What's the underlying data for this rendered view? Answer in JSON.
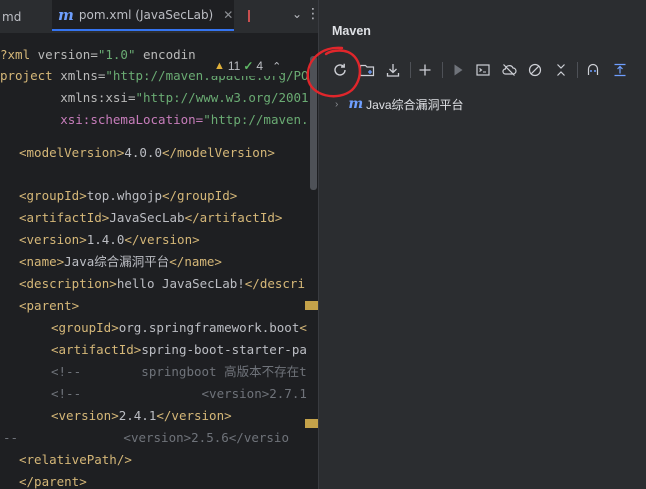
{
  "editor": {
    "tabs": [
      {
        "label": "md"
      },
      {
        "label": "pom.xml (JavaSecLab)",
        "icon": "maven-m-icon",
        "active": true
      }
    ],
    "inspection": {
      "warnings": "11",
      "passed": "4"
    },
    "code": {
      "l1_open": "?xml",
      "l1_attr1": " version=",
      "l1_val1": "\"1.0\"",
      "l1_attr2": " encodin",
      "l2_open": "project",
      "l2_attr": " xmlns=",
      "l2_val": "\"http://maven.apache.org/PO",
      "l3_pre": "        ",
      "l3_attr": "xmlns:xsi=",
      "l3_val": "\"http://www.w3.org/2001",
      "l4_pre": "        ",
      "l4_attr": "xsi:schemaLocation=",
      "l4_val": "\"http://maven.",
      "l5_open": "<modelVersion>",
      "l5_text": "4.0.0",
      "l5_close": "</modelVersion>",
      "l7_open": "<groupId>",
      "l7_text": "top.whgojp",
      "l7_close": "</groupId>",
      "l8_open": "<artifactId>",
      "l8_text": "JavaSecLab",
      "l8_close": "</artifactId>",
      "l9_open": "<version>",
      "l9_text": "1.4.0",
      "l9_close": "</version>",
      "l10_open": "<name>",
      "l10_text": "Java综合漏洞平台",
      "l10_close": "</name>",
      "l11_open": "<description>",
      "l11_text": "hello JavaSecLab!",
      "l11_close": "</descri",
      "l12_open": "<parent>",
      "l13_open": "<groupId>",
      "l13_text": "org.springframework.boot",
      "l13_close": "<",
      "l14_open": "<artifactId>",
      "l14_text": "spring-boot-starter-pa",
      "l15_text": "<!--        springboot 高版本不存在t",
      "l16_text": "<!--                <version>2.7.1",
      "l17_open": "<version>",
      "l17_text": "2.4.1",
      "l17_close": "</version>",
      "l18_pre": "--",
      "l18_text": "              <version>2.5.6</versio",
      "l19_open": "<relativePath/>",
      "l20_open": "</parent>"
    }
  },
  "maven": {
    "title": "Maven",
    "toolbar": [
      {
        "icon": "reload-icon"
      },
      {
        "icon": "add-folder-icon"
      },
      {
        "icon": "download-icon"
      },
      {
        "icon": "plus-icon"
      },
      {
        "icon": "run-icon"
      },
      {
        "icon": "terminal-icon"
      },
      {
        "icon": "offline-icon"
      },
      {
        "icon": "skip-tests-icon"
      },
      {
        "icon": "collapse-icon"
      },
      {
        "icon": "analyze-icon"
      },
      {
        "icon": "expand-icon"
      }
    ],
    "tree": [
      {
        "label": "Java综合漏洞平台",
        "icon": "maven-m-icon"
      }
    ]
  },
  "colors": {
    "accent": "#3574f0",
    "annotation": "#e0262b",
    "tag": "#d5b778",
    "string": "#6aab73"
  }
}
